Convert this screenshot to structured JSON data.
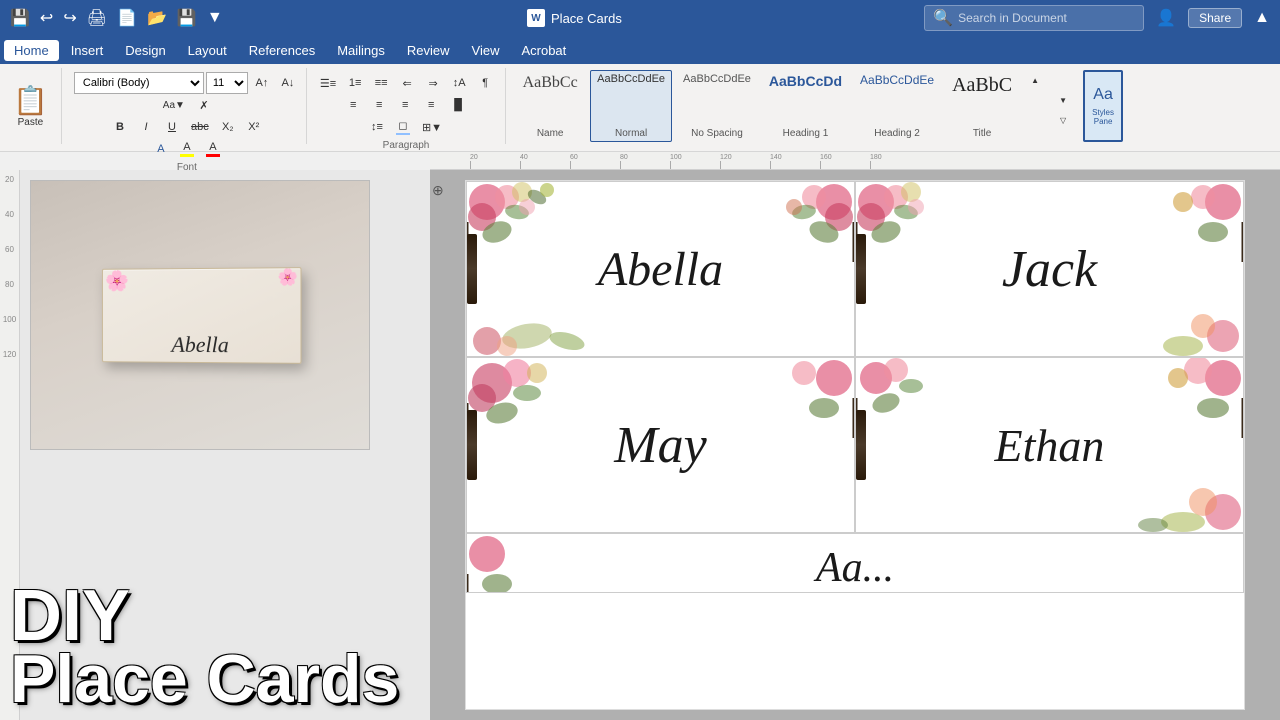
{
  "titlebar": {
    "app_name": "Place Cards",
    "doc_icon": "W",
    "search_placeholder": "Search in Document"
  },
  "menu": {
    "items": [
      "Home",
      "Insert",
      "Design",
      "Layout",
      "References",
      "Mailings",
      "Review",
      "View",
      "Acrobat"
    ]
  },
  "ribbon": {
    "active_tab": "Home",
    "font_family": "Calibri (Body)",
    "font_size": "11",
    "paste_label": "Paste",
    "styles": [
      {
        "id": "name",
        "label": "Name",
        "preview": "AaBbCc",
        "active": false
      },
      {
        "id": "normal",
        "label": "Normal",
        "preview": "AaBbCcDdEe",
        "active": true
      },
      {
        "id": "no-spacing",
        "label": "No Spacing",
        "preview": "AaBbCcDdEe",
        "active": false
      },
      {
        "id": "heading1",
        "label": "Heading 1",
        "preview": "AaBbCcDd",
        "active": false
      },
      {
        "id": "heading2",
        "label": "Heading 2",
        "preview": "AaBbCcDdEe",
        "active": false
      },
      {
        "id": "title",
        "label": "Title",
        "preview": "AaBbC",
        "active": false
      }
    ],
    "styles_pane_label": "Styles Pane"
  },
  "cards": [
    {
      "id": "card1",
      "name": "Abella"
    },
    {
      "id": "card2",
      "name": "Jack"
    },
    {
      "id": "card3",
      "name": "May"
    },
    {
      "id": "card4",
      "name": "Ethan"
    },
    {
      "id": "card5",
      "name": "..."
    }
  ],
  "overlay": {
    "line1": "DIY",
    "line2": "Place Cards"
  },
  "thumbnail": {
    "name": "Abella"
  },
  "ruler": {
    "marks": [
      20,
      40,
      60,
      80,
      100,
      120,
      140,
      160,
      180
    ],
    "vertical_marks": [
      20,
      40,
      60,
      80,
      100,
      120
    ]
  },
  "share_label": "Share",
  "styles_heading_label": "Heading"
}
